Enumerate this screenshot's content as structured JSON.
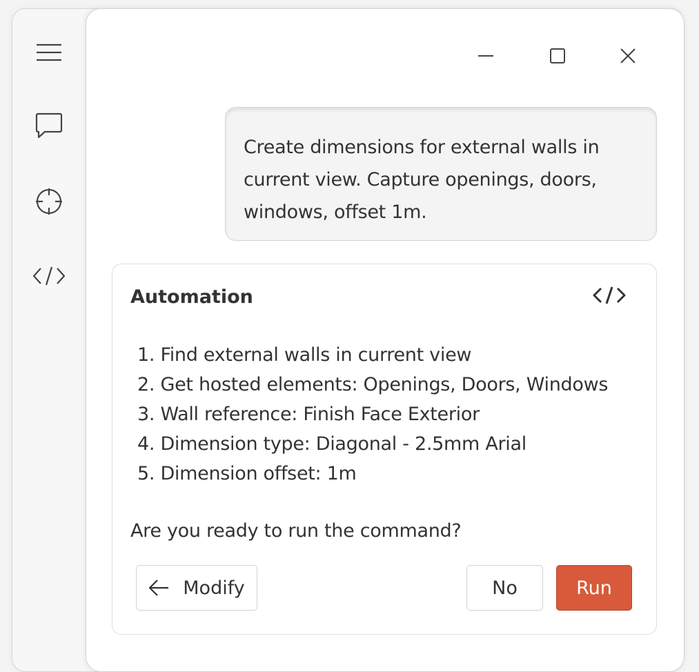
{
  "sidebar": {
    "items": [
      {
        "icon": "hamburger-menu-icon"
      },
      {
        "icon": "chat-icon"
      },
      {
        "icon": "crosshair-icon"
      },
      {
        "icon": "code-icon"
      }
    ]
  },
  "window_controls": {
    "minimize_icon": "minimize-icon",
    "maximize_icon": "maximize-icon",
    "close_icon": "close-icon"
  },
  "user_message": {
    "lines": [
      "Create dimensions for external walls in",
      "current view. Capture openings, doors,",
      "windows, offset 1m."
    ]
  },
  "automation_card": {
    "title": "Automation",
    "code_icon": "code-icon",
    "steps": [
      "1. Find external walls in current view",
      "2. Get hosted elements: Openings, Doors, Windows",
      "3. Wall reference: Finish Face Exterior",
      "4. Dimension type: Diagonal - 2.5mm Arial",
      "5. Dimension offset: 1m"
    ],
    "question": "Are you ready to run the command?",
    "buttons": {
      "modify_label": "Modify",
      "no_label": "No",
      "run_label": "Run"
    }
  },
  "colors": {
    "run_button": "#d85a3a",
    "text": "#333333",
    "panel_bg": "#ffffff",
    "sidebar_bg": "#f7f7f7"
  }
}
